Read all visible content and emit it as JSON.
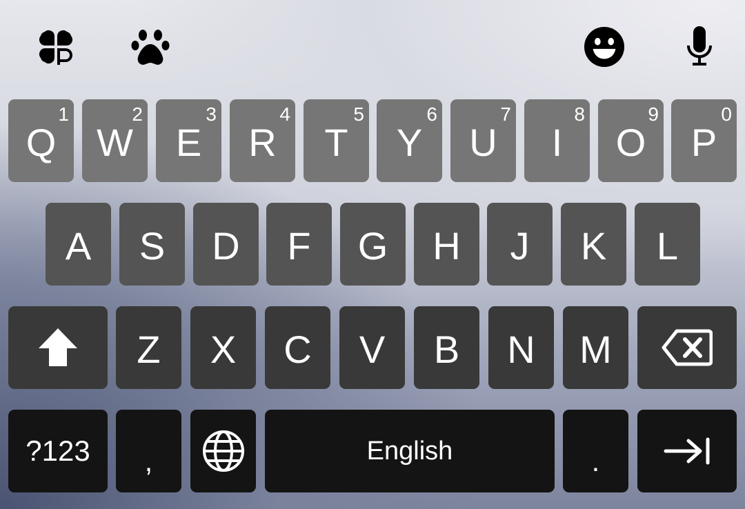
{
  "toolbar": {
    "left_icons": [
      "clover-icon",
      "paw-icon"
    ],
    "right_icons": [
      "emoji-icon",
      "microphone-icon"
    ]
  },
  "rows": {
    "row1": [
      {
        "letter": "Q",
        "hint": "1"
      },
      {
        "letter": "W",
        "hint": "2"
      },
      {
        "letter": "E",
        "hint": "3"
      },
      {
        "letter": "R",
        "hint": "4"
      },
      {
        "letter": "T",
        "hint": "5"
      },
      {
        "letter": "Y",
        "hint": "6"
      },
      {
        "letter": "U",
        "hint": "7"
      },
      {
        "letter": "I",
        "hint": "8"
      },
      {
        "letter": "O",
        "hint": "9"
      },
      {
        "letter": "P",
        "hint": "0"
      }
    ],
    "row2": [
      "A",
      "S",
      "D",
      "F",
      "G",
      "H",
      "J",
      "K",
      "L"
    ],
    "row3": [
      "Z",
      "X",
      "C",
      "V",
      "B",
      "N",
      "M"
    ]
  },
  "bottom": {
    "symbols_label": "?123",
    "comma_label": ",",
    "space_label": "English",
    "period_label": "."
  },
  "special_icons": {
    "shift": "shift-arrow-icon",
    "backspace": "backspace-icon",
    "language": "globe-icon",
    "enter": "tab-arrow-icon"
  },
  "colors": {
    "row1_key": "#767676",
    "row2_key": "#545454",
    "row3_key": "#393939",
    "row4_key": "#141414",
    "key_text": "#ffffff",
    "toolbar_icon": "#000000"
  }
}
